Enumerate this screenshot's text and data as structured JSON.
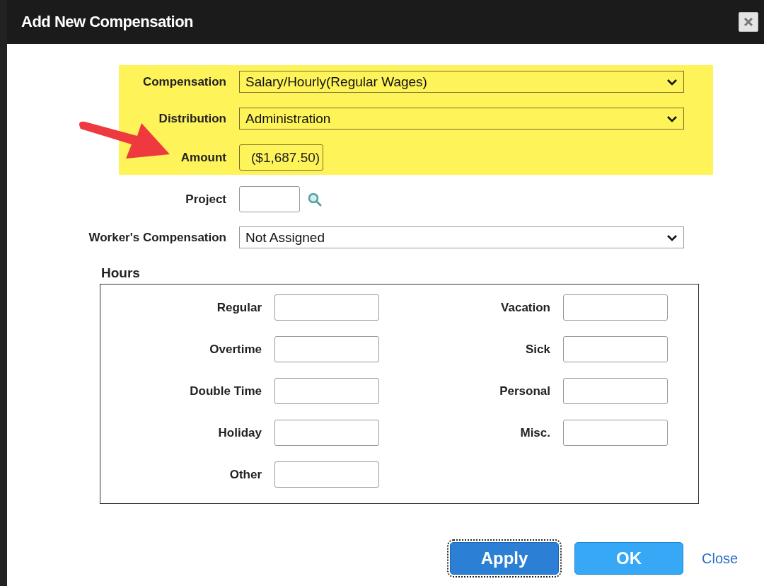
{
  "window": {
    "title": "Add New Compensation"
  },
  "highlighted_fields": [
    {
      "label": "Compensation",
      "kind": "select",
      "value": "Salary/Hourly(Regular Wages)"
    },
    {
      "label": "Distribution",
      "kind": "select",
      "value": "Administration"
    },
    {
      "label": "Amount",
      "kind": "readonly",
      "value": "($1,687.50)"
    }
  ],
  "fields": [
    {
      "label": "Project",
      "kind": "lookup"
    },
    {
      "label": "Worker's Compensation",
      "kind": "select",
      "value": "Not Assigned"
    }
  ],
  "hours": {
    "title": "Hours",
    "left": [
      {
        "label": "Regular"
      },
      {
        "label": "Overtime"
      },
      {
        "label": "Double Time"
      },
      {
        "label": "Holiday"
      },
      {
        "label": "Other"
      }
    ],
    "right": [
      {
        "label": "Vacation"
      },
      {
        "label": "Sick"
      },
      {
        "label": "Personal"
      },
      {
        "label": "Misc."
      }
    ]
  },
  "buttons": [
    {
      "label": "Apply",
      "kind": "primary",
      "focused": true
    },
    {
      "label": "OK",
      "kind": "secondary",
      "focused": false
    },
    {
      "label": "Close",
      "kind": "link",
      "focused": false
    }
  ]
}
